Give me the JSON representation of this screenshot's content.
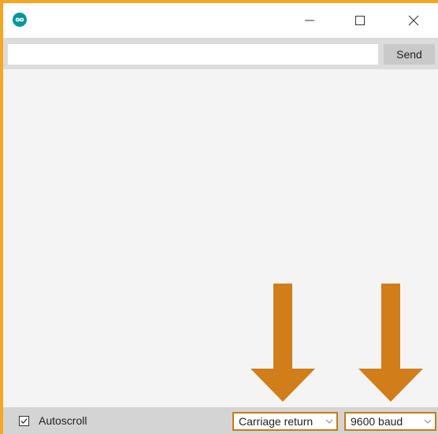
{
  "window": {
    "app_icon": "arduino-infinity-icon",
    "border_color": "#f5a623",
    "controls": {
      "minimize_icon": "minimize-icon",
      "maximize_icon": "maximize-icon",
      "close_icon": "close-icon"
    }
  },
  "send_bar": {
    "input_value": "",
    "send_label": "Send"
  },
  "output": {
    "text": ""
  },
  "bottom_bar": {
    "autoscroll_label": "Autoscroll",
    "autoscroll_checked": true,
    "line_ending": "Carriage return",
    "baud_rate": "9600 baud"
  },
  "annotations": {
    "arrow_color": "#d07d1a",
    "highlight_color": "#c97a14"
  }
}
